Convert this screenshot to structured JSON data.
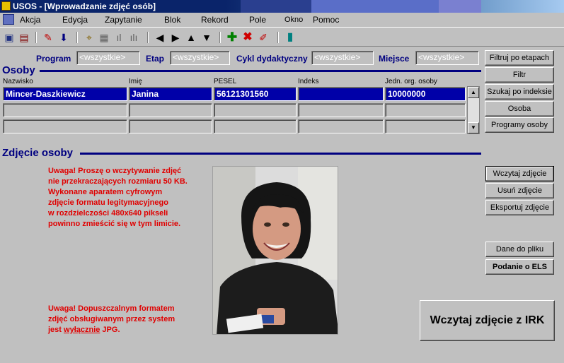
{
  "window": {
    "title": "USOS - [Wprowadzanie zdjęć osób]"
  },
  "menu": [
    "Akcja",
    "Edycja",
    "Zapytanie",
    "Blok",
    "Rekord",
    "Pole",
    "Okno",
    "Pomoc"
  ],
  "filters": {
    "program_label": "Program",
    "program_value": "<wszystkie>",
    "etap_label": "Etap",
    "etap_value": "<wszystkie>",
    "cykl_label": "Cykl dydaktyczny",
    "cykl_value": "<wszystkie>",
    "miejsce_label": "Miejsce",
    "miejsce_value": "<wszystkie>"
  },
  "osoby": {
    "title": "Osoby",
    "columns": [
      "Nazwisko",
      "Imię",
      "PESEL",
      "Indeks",
      "Jedn. org. osoby"
    ],
    "rows": [
      [
        "Mincer-Daszkiewicz",
        "Janina",
        "56121301560",
        "",
        "10000000"
      ]
    ]
  },
  "right_buttons": [
    "Filtruj po etapach",
    "Filtr",
    "Szukaj po indeksie",
    "Osoba",
    "Programy osoby"
  ],
  "zdjecie": {
    "title": "Zdjęcie osoby",
    "warning1": [
      "Uwaga! Proszę o wczytywanie zdjęć",
      "nie przekraczających rozmiaru 50 KB.",
      "Wykonane aparatem cyfrowym",
      "zdjęcie formatu legitymacyjnego",
      "w rozdzielczości 480x640 pikseli",
      "powinno zmieścić się w tym limicie."
    ],
    "warning2_line1": "Uwaga! Dopuszczalnym formatem",
    "warning2_line2": "zdjęć obsługiwanym przez system",
    "warning2_pre": "jest ",
    "warning2_underlined": "wyłącznie",
    "warning2_post": " JPG."
  },
  "photo_buttons": {
    "load": "Wczytaj zdjęcie",
    "delete": "Usuń zdjęcie",
    "export": "Eksportuj zdjęcie"
  },
  "other_buttons": {
    "data_to_file": "Dane do pliku",
    "els": "Podanie o ELS",
    "irk": "Wczytaj zdjęcie z IRK"
  },
  "colors": {
    "accent": "#000080",
    "selection": "#0000a8",
    "warning": "#e00000"
  }
}
